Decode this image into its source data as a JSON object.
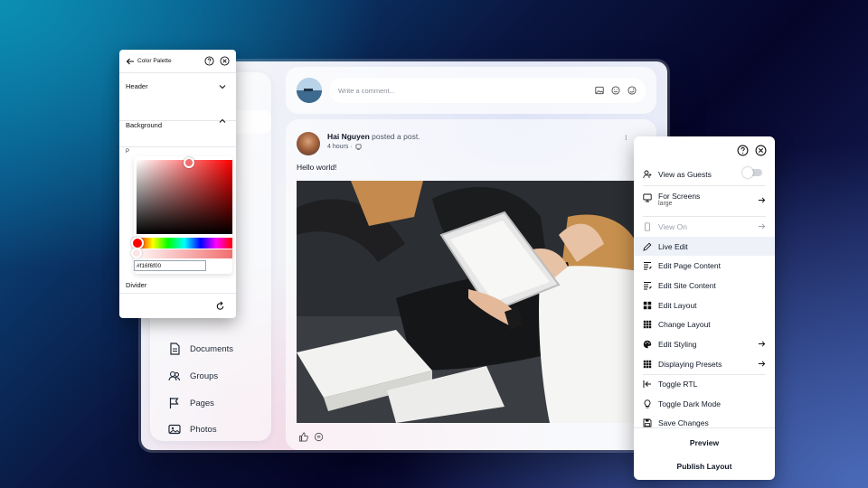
{
  "composer": {
    "placeholder": "Write a comment..."
  },
  "nav": {
    "items": [
      {
        "label": "Documents",
        "icon": "document-icon"
      },
      {
        "label": "Groups",
        "icon": "groups-icon"
      },
      {
        "label": "Pages",
        "icon": "flag-icon"
      },
      {
        "label": "Photos",
        "icon": "photos-icon"
      }
    ]
  },
  "post": {
    "author": "Hai Nguyen",
    "action": "posted a post.",
    "time": "4 hours ·",
    "text": "Hello world!"
  },
  "palette": {
    "title": "Color Palette",
    "sections": {
      "header": "Header",
      "background": "Background",
      "divider": "Divider"
    },
    "label_partial": "P",
    "hex_value": "#f16f6f00",
    "selected_color": "#f16f6f"
  },
  "settings_menu": {
    "items": [
      {
        "label": "View as Guests",
        "icon": "user-icon"
      },
      {
        "label": "For Screens",
        "sub": "large",
        "icon": "monitor-icon"
      },
      {
        "label": "View On",
        "icon": "phone-icon"
      },
      {
        "label": "Live Edit",
        "icon": "pencil-icon"
      },
      {
        "label": "Edit Page Content",
        "icon": "page-edit-icon"
      },
      {
        "label": "Edit Site Content",
        "icon": "site-edit-icon"
      },
      {
        "label": "Edit Layout",
        "icon": "layout-icon"
      },
      {
        "label": "Change Layout",
        "icon": "grid-icon"
      },
      {
        "label": "Edit Styling",
        "icon": "palette-icon"
      },
      {
        "label": "Displaying Presets",
        "icon": "presets-icon"
      },
      {
        "label": "Toggle RTL",
        "icon": "rtl-icon"
      },
      {
        "label": "Toggle Dark Mode",
        "icon": "bulb-icon"
      },
      {
        "label": "Save Changes",
        "icon": "save-icon"
      }
    ],
    "preview_label": "Preview",
    "publish_label": "Publish Layout"
  }
}
